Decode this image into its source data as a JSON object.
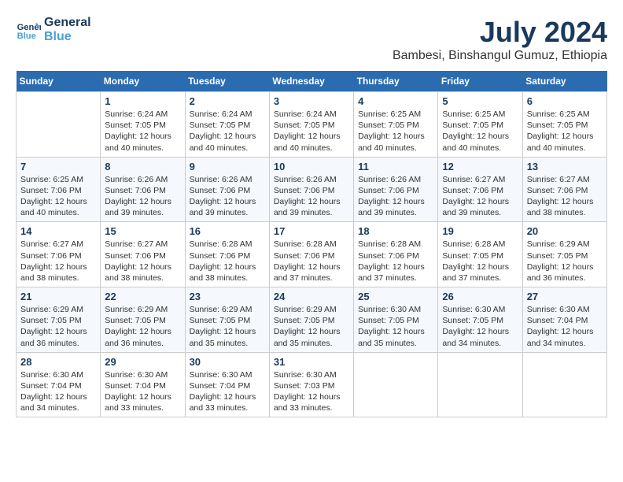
{
  "header": {
    "logo_line1": "General",
    "logo_line2": "Blue",
    "month_year": "July 2024",
    "location": "Bambesi, Binshangul Gumuz, Ethiopia"
  },
  "columns": [
    "Sunday",
    "Monday",
    "Tuesday",
    "Wednesday",
    "Thursday",
    "Friday",
    "Saturday"
  ],
  "weeks": [
    [
      {
        "day": "",
        "content": ""
      },
      {
        "day": "1",
        "content": "Sunrise: 6:24 AM\nSunset: 7:05 PM\nDaylight: 12 hours\nand 40 minutes."
      },
      {
        "day": "2",
        "content": "Sunrise: 6:24 AM\nSunset: 7:05 PM\nDaylight: 12 hours\nand 40 minutes."
      },
      {
        "day": "3",
        "content": "Sunrise: 6:24 AM\nSunset: 7:05 PM\nDaylight: 12 hours\nand 40 minutes."
      },
      {
        "day": "4",
        "content": "Sunrise: 6:25 AM\nSunset: 7:05 PM\nDaylight: 12 hours\nand 40 minutes."
      },
      {
        "day": "5",
        "content": "Sunrise: 6:25 AM\nSunset: 7:05 PM\nDaylight: 12 hours\nand 40 minutes."
      },
      {
        "day": "6",
        "content": "Sunrise: 6:25 AM\nSunset: 7:05 PM\nDaylight: 12 hours\nand 40 minutes."
      }
    ],
    [
      {
        "day": "7",
        "content": "Sunrise: 6:25 AM\nSunset: 7:06 PM\nDaylight: 12 hours\nand 40 minutes."
      },
      {
        "day": "8",
        "content": "Sunrise: 6:26 AM\nSunset: 7:06 PM\nDaylight: 12 hours\nand 39 minutes."
      },
      {
        "day": "9",
        "content": "Sunrise: 6:26 AM\nSunset: 7:06 PM\nDaylight: 12 hours\nand 39 minutes."
      },
      {
        "day": "10",
        "content": "Sunrise: 6:26 AM\nSunset: 7:06 PM\nDaylight: 12 hours\nand 39 minutes."
      },
      {
        "day": "11",
        "content": "Sunrise: 6:26 AM\nSunset: 7:06 PM\nDaylight: 12 hours\nand 39 minutes."
      },
      {
        "day": "12",
        "content": "Sunrise: 6:27 AM\nSunset: 7:06 PM\nDaylight: 12 hours\nand 39 minutes."
      },
      {
        "day": "13",
        "content": "Sunrise: 6:27 AM\nSunset: 7:06 PM\nDaylight: 12 hours\nand 38 minutes."
      }
    ],
    [
      {
        "day": "14",
        "content": "Sunrise: 6:27 AM\nSunset: 7:06 PM\nDaylight: 12 hours\nand 38 minutes."
      },
      {
        "day": "15",
        "content": "Sunrise: 6:27 AM\nSunset: 7:06 PM\nDaylight: 12 hours\nand 38 minutes."
      },
      {
        "day": "16",
        "content": "Sunrise: 6:28 AM\nSunset: 7:06 PM\nDaylight: 12 hours\nand 38 minutes."
      },
      {
        "day": "17",
        "content": "Sunrise: 6:28 AM\nSunset: 7:06 PM\nDaylight: 12 hours\nand 37 minutes."
      },
      {
        "day": "18",
        "content": "Sunrise: 6:28 AM\nSunset: 7:06 PM\nDaylight: 12 hours\nand 37 minutes."
      },
      {
        "day": "19",
        "content": "Sunrise: 6:28 AM\nSunset: 7:05 PM\nDaylight: 12 hours\nand 37 minutes."
      },
      {
        "day": "20",
        "content": "Sunrise: 6:29 AM\nSunset: 7:05 PM\nDaylight: 12 hours\nand 36 minutes."
      }
    ],
    [
      {
        "day": "21",
        "content": "Sunrise: 6:29 AM\nSunset: 7:05 PM\nDaylight: 12 hours\nand 36 minutes."
      },
      {
        "day": "22",
        "content": "Sunrise: 6:29 AM\nSunset: 7:05 PM\nDaylight: 12 hours\nand 36 minutes."
      },
      {
        "day": "23",
        "content": "Sunrise: 6:29 AM\nSunset: 7:05 PM\nDaylight: 12 hours\nand 35 minutes."
      },
      {
        "day": "24",
        "content": "Sunrise: 6:29 AM\nSunset: 7:05 PM\nDaylight: 12 hours\nand 35 minutes."
      },
      {
        "day": "25",
        "content": "Sunrise: 6:30 AM\nSunset: 7:05 PM\nDaylight: 12 hours\nand 35 minutes."
      },
      {
        "day": "26",
        "content": "Sunrise: 6:30 AM\nSunset: 7:05 PM\nDaylight: 12 hours\nand 34 minutes."
      },
      {
        "day": "27",
        "content": "Sunrise: 6:30 AM\nSunset: 7:04 PM\nDaylight: 12 hours\nand 34 minutes."
      }
    ],
    [
      {
        "day": "28",
        "content": "Sunrise: 6:30 AM\nSunset: 7:04 PM\nDaylight: 12 hours\nand 34 minutes."
      },
      {
        "day": "29",
        "content": "Sunrise: 6:30 AM\nSunset: 7:04 PM\nDaylight: 12 hours\nand 33 minutes."
      },
      {
        "day": "30",
        "content": "Sunrise: 6:30 AM\nSunset: 7:04 PM\nDaylight: 12 hours\nand 33 minutes."
      },
      {
        "day": "31",
        "content": "Sunrise: 6:30 AM\nSunset: 7:03 PM\nDaylight: 12 hours\nand 33 minutes."
      },
      {
        "day": "",
        "content": ""
      },
      {
        "day": "",
        "content": ""
      },
      {
        "day": "",
        "content": ""
      }
    ]
  ]
}
